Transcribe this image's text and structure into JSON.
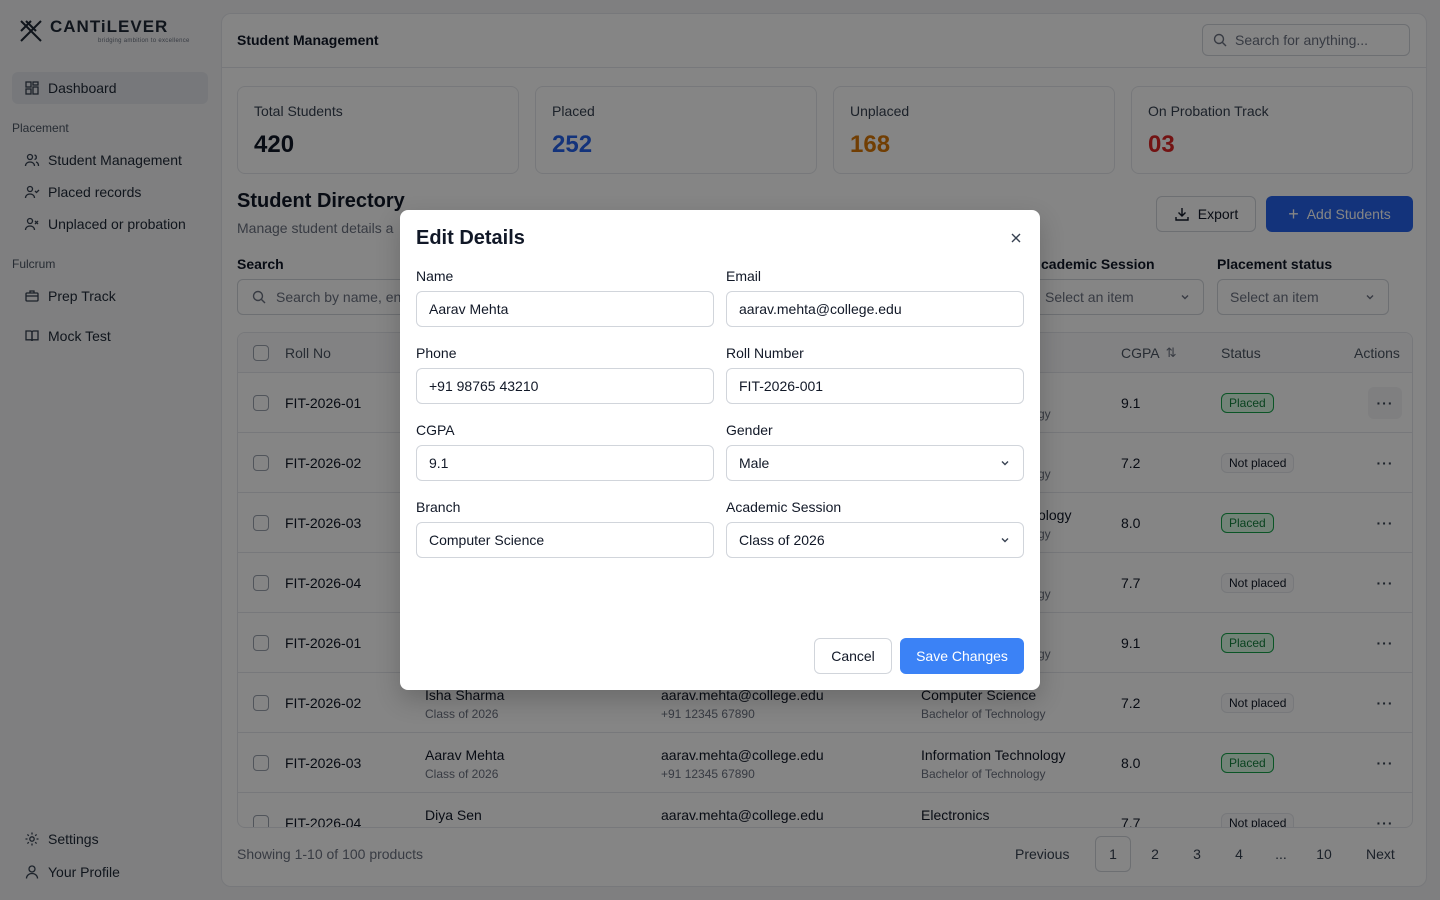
{
  "app": {
    "logo_text": "CANTiLEVER",
    "logo_tagline": "bridging ambition to excellence",
    "page_title": "Student Management",
    "global_search_placeholder": "Search for anything..."
  },
  "sidebar": {
    "dashboard": "Dashboard",
    "section_placement": "Placement",
    "student_management": "Student Management",
    "placed_records": "Placed records",
    "unplaced_or_probation": "Unplaced or probation",
    "section_fulcrum": "Fulcrum",
    "prep_track": "Prep Track",
    "mock_test": "Mock Test",
    "settings": "Settings",
    "your_profile": "Your Profile"
  },
  "stats": [
    {
      "label": "Total Students",
      "value": "420",
      "color": "#111827"
    },
    {
      "label": "Placed",
      "value": "252",
      "color": "#2563eb"
    },
    {
      "label": "Unplaced",
      "value": "168",
      "color": "#d97706"
    },
    {
      "label": "On Probation Track",
      "value": "03",
      "color": "#dc2626"
    }
  ],
  "directory": {
    "title": "Student Directory",
    "subtitle": "Manage student details a",
    "export_label": "Export",
    "add_label": "Add Students"
  },
  "filters": {
    "search_label": "Search",
    "search_placeholder": "Search by name, en",
    "session_label": "cademic Session",
    "session_placeholder": "Select an item",
    "status_label": "Placement status",
    "status_placeholder": "Select an item"
  },
  "table": {
    "headers": {
      "roll": "Roll No",
      "cgpa": "CGPA",
      "status": "Status",
      "actions": "Actions"
    },
    "rows": [
      {
        "roll": "FIT-2026-01",
        "branch_tail": "",
        "branch_sub_tail": "gy",
        "cgpa": "9.1",
        "status": "Placed"
      },
      {
        "roll": "FIT-2026-02",
        "branch_tail": "",
        "branch_sub_tail": "gy",
        "cgpa": "7.2",
        "status": "Not placed"
      },
      {
        "roll": "FIT-2026-03",
        "branch_tail": "ology",
        "branch_sub_tail": "gy",
        "cgpa": "8.0",
        "status": "Placed"
      },
      {
        "roll": "FIT-2026-04",
        "branch_tail": "",
        "branch_sub_tail": "gy",
        "cgpa": "7.7",
        "status": "Not placed"
      },
      {
        "roll": "FIT-2026-01",
        "branch_tail": "",
        "branch_sub_tail": "gy",
        "cgpa": "9.1",
        "status": "Placed"
      },
      {
        "roll": "FIT-2026-02",
        "name": "Isha Sharma",
        "session": "Class of 2026",
        "email": "aarav.mehta@college.edu",
        "phone": "+91 12345 67890",
        "branch": "Computer Science",
        "degree": "Bachelor of Technology",
        "cgpa": "7.2",
        "status": "Not placed"
      },
      {
        "roll": "FIT-2026-03",
        "name": "Aarav Mehta",
        "session": "Class of 2026",
        "email": "aarav.mehta@college.edu",
        "phone": "+91 12345 67890",
        "branch": "Information Technology",
        "degree": "Bachelor of Technology",
        "cgpa": "8.0",
        "status": "Placed"
      },
      {
        "roll": "FIT-2026-04",
        "name": "Diya Sen",
        "session": "",
        "email": "aarav.mehta@college.edu",
        "phone": "",
        "branch": "Electronics",
        "degree": "",
        "cgpa": "7.7",
        "status": "Not placed"
      }
    ]
  },
  "pagination": {
    "info": "Showing 1-10 of 100 products",
    "previous": "Previous",
    "pages": [
      "1",
      "2",
      "3",
      "4",
      "...",
      "10"
    ],
    "next": "Next"
  },
  "modal": {
    "title": "Edit Details",
    "name_label": "Name",
    "name_value": "Aarav Mehta",
    "email_label": "Email",
    "email_value": "aarav.mehta@college.edu",
    "phone_label": "Phone",
    "phone_value": "+91 98765 43210",
    "roll_label": "Roll Number",
    "roll_value": "FIT-2026-001",
    "cgpa_label": "CGPA",
    "cgpa_value": "9.1",
    "gender_label": "Gender",
    "gender_value": "Male",
    "branch_label": "Branch",
    "branch_value": "Computer Science",
    "session_label": "Academic Session",
    "session_value": "Class of 2026",
    "cancel_label": "Cancel",
    "save_label": "Save Changes"
  },
  "colors": {
    "accent": "#2563eb",
    "save_button": "#3b82f6",
    "placed_badge": "#16a34a"
  }
}
